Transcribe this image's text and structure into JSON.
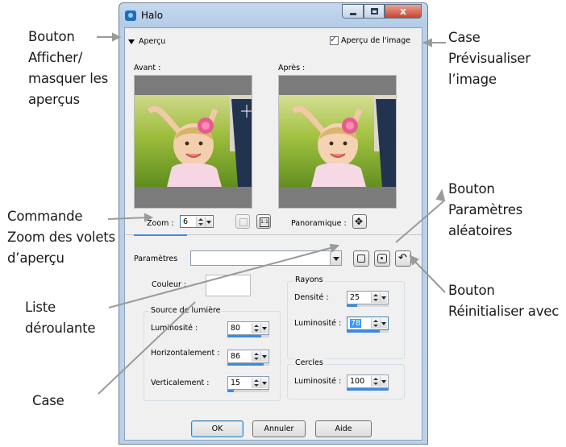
{
  "window": {
    "title": "Halo",
    "minimize": "–",
    "maximize": "□",
    "close": "x"
  },
  "preview": {
    "toggle_label": "Aperçu",
    "show_preview_label": "Aperçu de l'image",
    "show_preview_checked": true,
    "before_label": "Avant :",
    "after_label": "Après :",
    "zoom_label": "Zoom :",
    "zoom_value": "6",
    "pan_label": "Panoramique :"
  },
  "presets": {
    "label": "Paramètres",
    "value": ""
  },
  "settings": {
    "color_label": "Couleur :",
    "light_group": "Source de lumière",
    "brightness_label": "Luminosité :",
    "brightness_value": "80",
    "horizontal_label": "Horizontalement :",
    "horizontal_value": "86",
    "vertical_label": "Verticalement :",
    "vertical_value": "15",
    "rays_group": "Rayons",
    "density_label": "Densité :",
    "density_value": "25",
    "rays_brightness_label": "Luminosité :",
    "rays_brightness_value": "78",
    "circles_group": "Cercles",
    "circles_brightness_label": "Luminosité :",
    "circles_brightness_value": "100"
  },
  "sliders": {
    "brightness": 0.8,
    "horizontal": 0.86,
    "vertical": 0.15,
    "density": 0.25,
    "rays_brightness": 0.78,
    "circles_brightness": 1.0
  },
  "buttons": {
    "ok": "OK",
    "cancel": "Annuler",
    "help": "Aide"
  },
  "callouts": {
    "toggle_preview": [
      "Bouton",
      "Afficher/",
      "masquer les",
      "aperçus"
    ],
    "preview_checkbox": [
      "Case",
      "Prévisualiser",
      "l’image"
    ],
    "zoom": [
      "Commande",
      "Zoom des volets",
      "d’aperçu"
    ],
    "random": [
      "Bouton",
      "Paramètres",
      "aléatoires"
    ],
    "dropdown": [
      "Liste",
      "déroulante"
    ],
    "reset": [
      "Bouton",
      "Réinitialiser avec"
    ],
    "checkbox": [
      "Case"
    ]
  },
  "colors": {
    "accent": "#3c8be0",
    "window_frame": "#b9d1ea",
    "close_button": "#c8452f"
  }
}
